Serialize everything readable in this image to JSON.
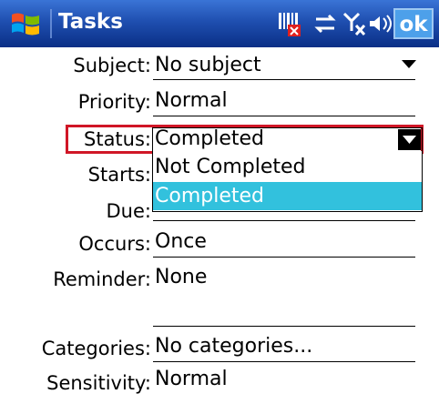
{
  "titlebar": {
    "app_title": "Tasks",
    "ok_label": "ok",
    "icons": [
      "windows-logo",
      "sim-missing",
      "connectivity",
      "no-signal",
      "volume"
    ]
  },
  "fields": {
    "subject": {
      "label": "Subject:",
      "value": "No subject"
    },
    "priority": {
      "label": "Priority:",
      "value": "Normal"
    },
    "status": {
      "label": "Status:",
      "value": "Completed",
      "options": [
        "Not Completed",
        "Completed"
      ],
      "selected": "Completed"
    },
    "starts": {
      "label": "Starts:"
    },
    "due": {
      "label": "Due:"
    },
    "occurs": {
      "label": "Occurs:",
      "value": "Once"
    },
    "reminder": {
      "label": "Reminder:",
      "value": "None"
    },
    "categories": {
      "label": "Categories:",
      "value": "No categories..."
    },
    "sensitivity": {
      "label": "Sensitivity:",
      "value": "Normal"
    }
  },
  "colors": {
    "titlebar": "#1f4fb0",
    "highlight": "#d01626",
    "selection": "#32c1dd",
    "ok_button": "#4da0ea"
  }
}
